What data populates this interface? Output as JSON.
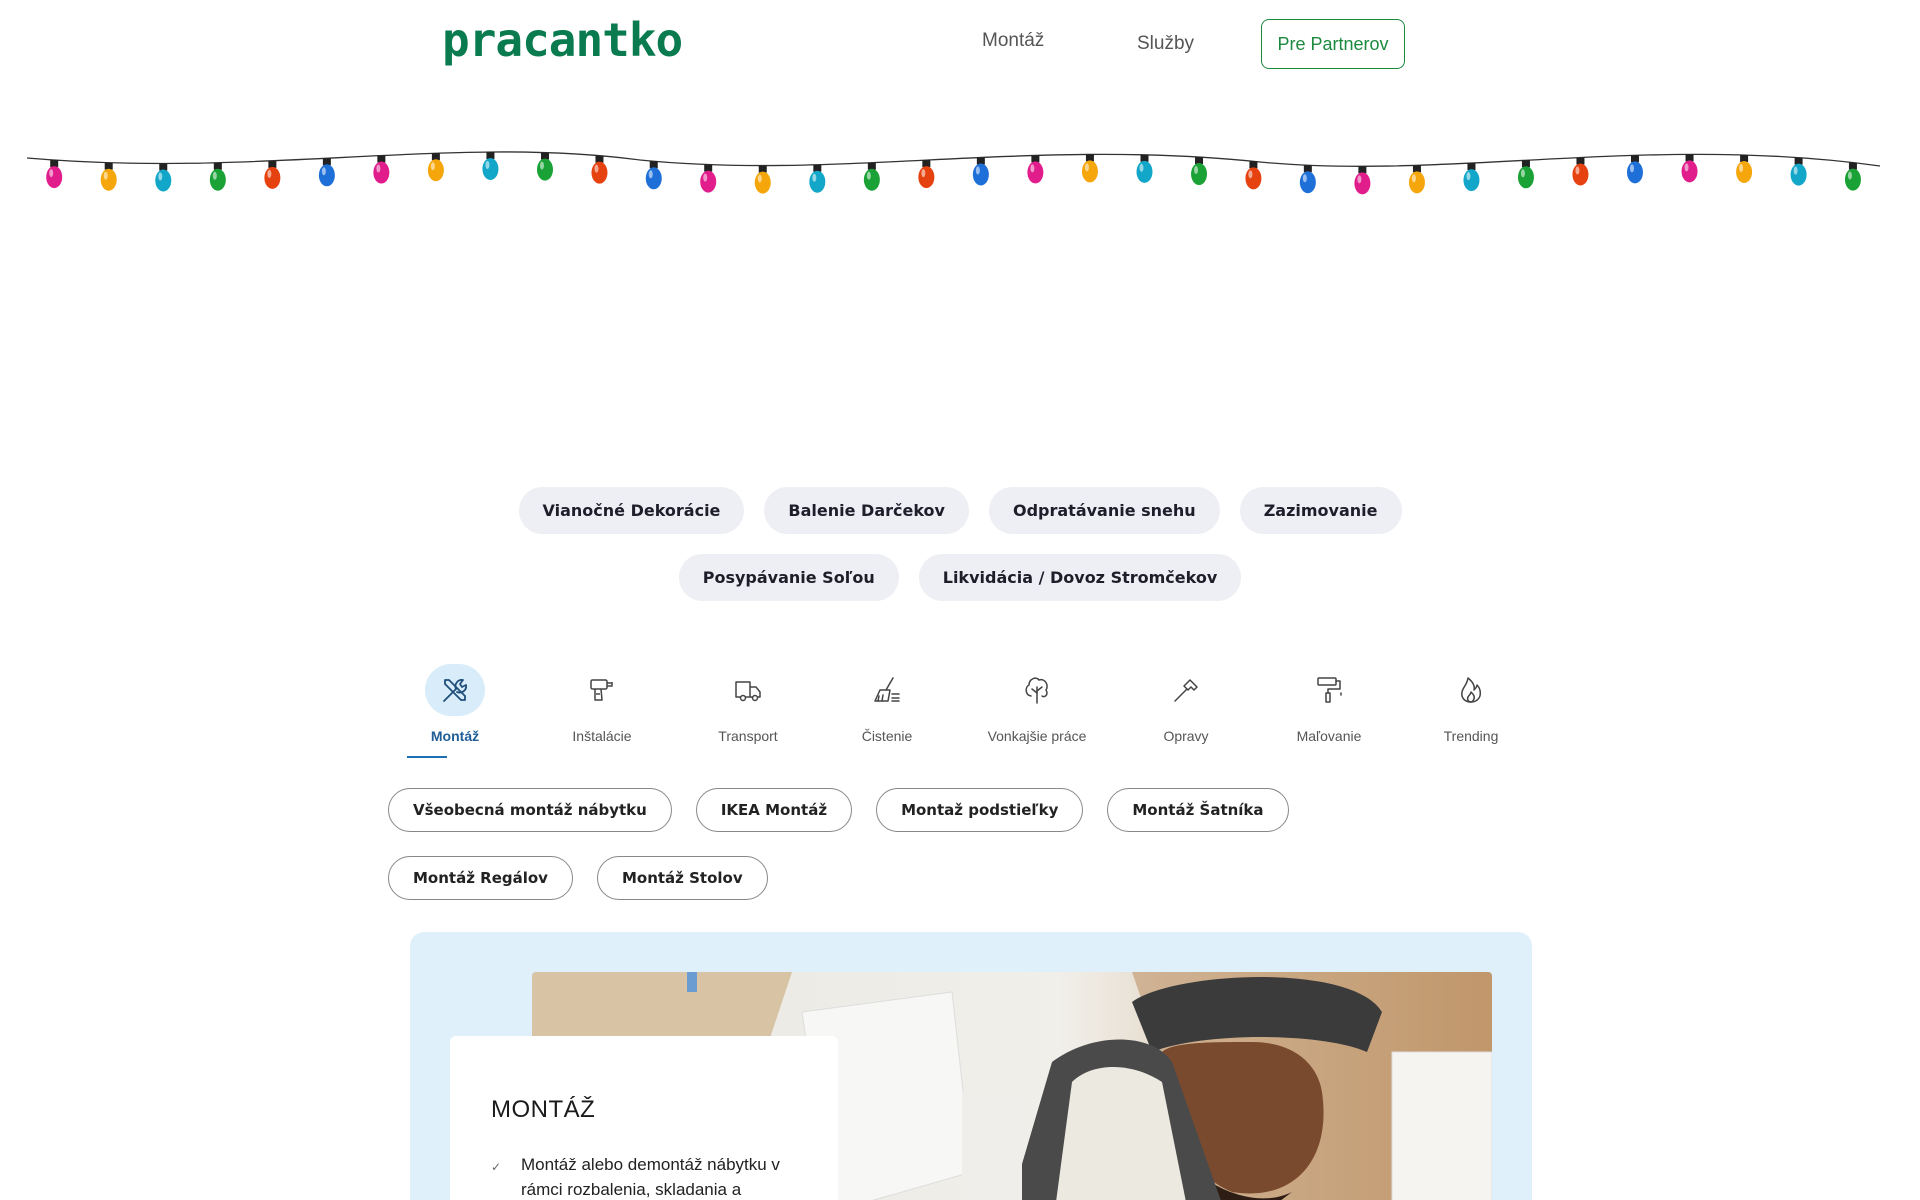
{
  "header": {
    "logo": "pracantko",
    "nav": [
      {
        "label": "Montáž"
      },
      {
        "label": "Služby"
      }
    ],
    "partner_button": "Pre Partnerov"
  },
  "colors": {
    "brand_green": "#0a7a4f",
    "partner_green": "#1b8a3e",
    "active_blue": "#1f5d96",
    "feature_bg": "#dff0fb",
    "chip_bg": "#eeeef5"
  },
  "decoration": {
    "lights_colors": [
      "#e11d8c",
      "#f5a60a",
      "#12a6c9",
      "#1aa236",
      "#e5420f",
      "#1f6fd9"
    ]
  },
  "season_chips": [
    "Vianočné Dekorácie",
    "Balenie Darčekov",
    "Odpratávanie snehu",
    "Zazimovanie",
    "Posypávanie Soľou",
    "Likvidácia / Dovoz Stromčekov"
  ],
  "categories": [
    {
      "label": "Montáž",
      "icon": "tools-icon",
      "active": true
    },
    {
      "label": "Inštalácie",
      "icon": "drill-icon"
    },
    {
      "label": "Transport",
      "icon": "truck-icon"
    },
    {
      "label": "Čistenie",
      "icon": "broom-icon"
    },
    {
      "label": "Vonkajšie práce",
      "icon": "tree-icon"
    },
    {
      "label": "Opravy",
      "icon": "hammer-icon"
    },
    {
      "label": "Maľovanie",
      "icon": "paint-roller-icon"
    },
    {
      "label": "Trending",
      "icon": "flame-icon"
    }
  ],
  "sub_chips": [
    "Všeobecná montáž nábytku",
    "IKEA Montáž",
    "Montaž podstieľky",
    "Montáž Šatníka",
    "Montáž Regálov",
    "Montáž Stolov"
  ],
  "feature": {
    "title": "MONTÁŽ",
    "items": [
      "Montáž alebo demontáž nábytku v rámci rozbalenia, skladania a"
    ]
  }
}
